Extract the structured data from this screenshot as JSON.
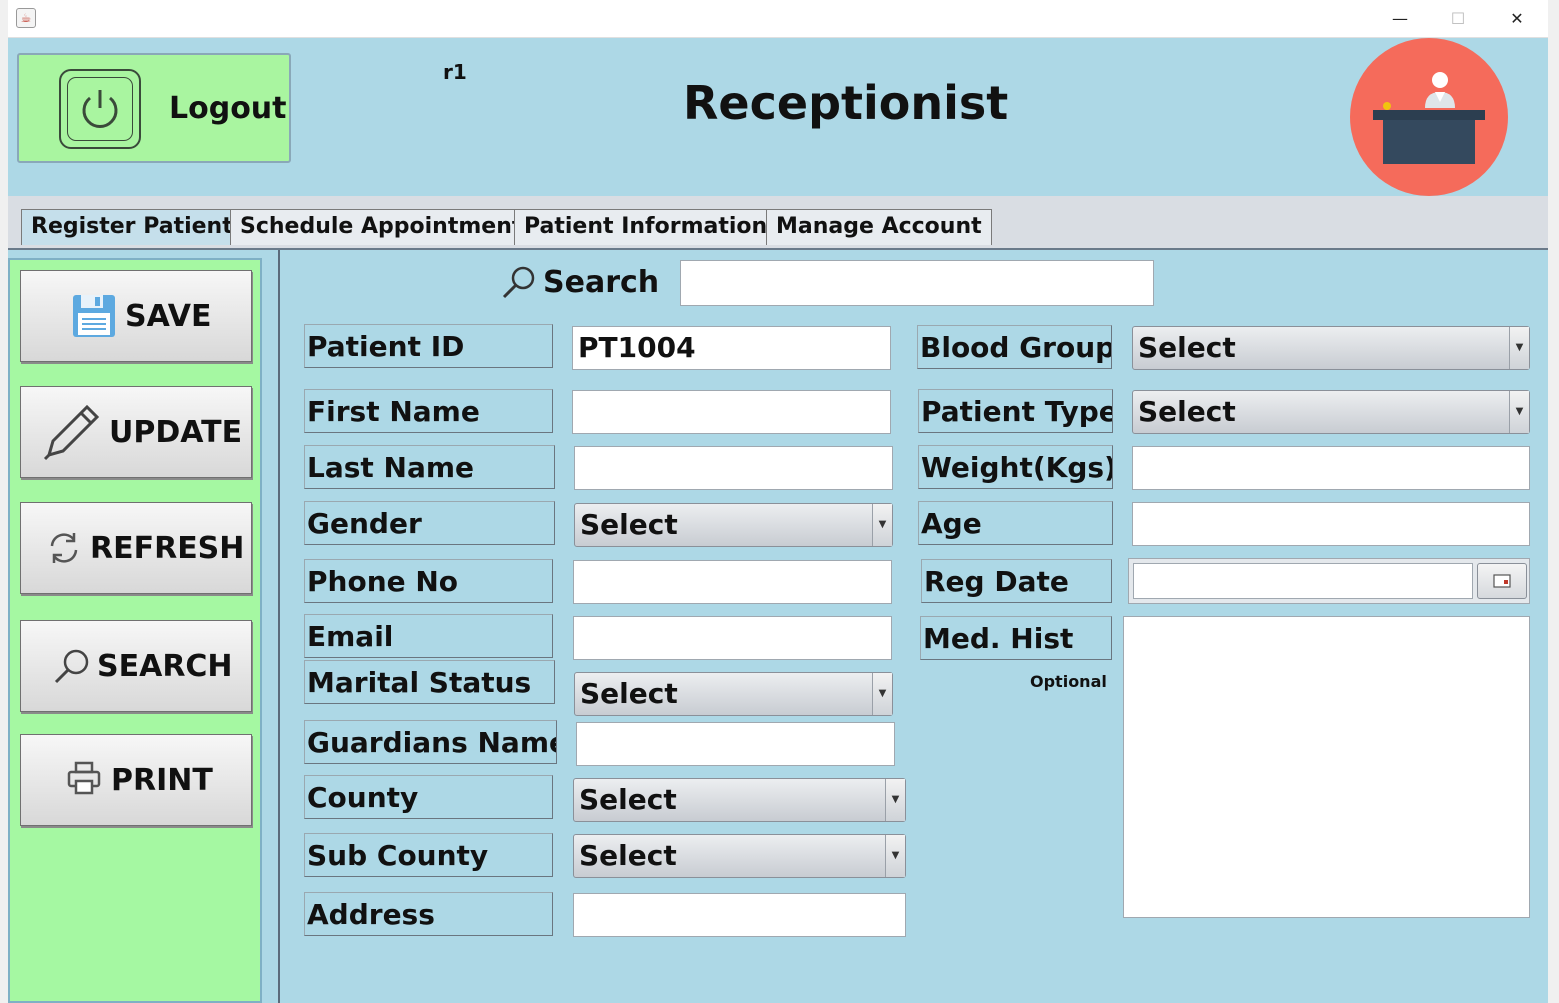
{
  "window": {
    "minimize": "—",
    "maximize": "☐",
    "close": "✕"
  },
  "header": {
    "logout_label": "Logout",
    "user": "r1",
    "title": "Receptionist"
  },
  "tabs": [
    {
      "label": "Register Patient"
    },
    {
      "label": "Schedule Appointment"
    },
    {
      "label": "Patient Information"
    },
    {
      "label": "Manage Account"
    }
  ],
  "sidebar": {
    "save": "SAVE",
    "update": "UPDATE",
    "refresh": "REFRESH",
    "search": "SEARCH",
    "print": "PRINT"
  },
  "search": {
    "label": "Search",
    "value": ""
  },
  "form": {
    "patient_id": {
      "label": "Patient ID",
      "value": "PT1004"
    },
    "first_name": {
      "label": "First Name",
      "value": ""
    },
    "last_name": {
      "label": "Last Name",
      "value": ""
    },
    "gender": {
      "label": "Gender",
      "value": "Select"
    },
    "phone": {
      "label": "Phone No",
      "value": ""
    },
    "email": {
      "label": "Email",
      "value": ""
    },
    "marital": {
      "label": "Marital Status",
      "value": "Select"
    },
    "guardian": {
      "label": "Guardians Name",
      "value": ""
    },
    "county": {
      "label": "County",
      "value": "Select"
    },
    "sub_county": {
      "label": "Sub County",
      "value": "Select"
    },
    "address": {
      "label": "Address",
      "value": ""
    },
    "blood_group": {
      "label": "Blood Group",
      "value": "Select"
    },
    "patient_type": {
      "label": "Patient Type",
      "value": "Select"
    },
    "weight": {
      "label": "Weight(Kgs)",
      "value": ""
    },
    "age": {
      "label": "Age",
      "value": ""
    },
    "reg_date": {
      "label": "Reg Date",
      "value": ""
    },
    "med_hist": {
      "label": "Med. Hist",
      "note": "Optional",
      "value": ""
    }
  }
}
